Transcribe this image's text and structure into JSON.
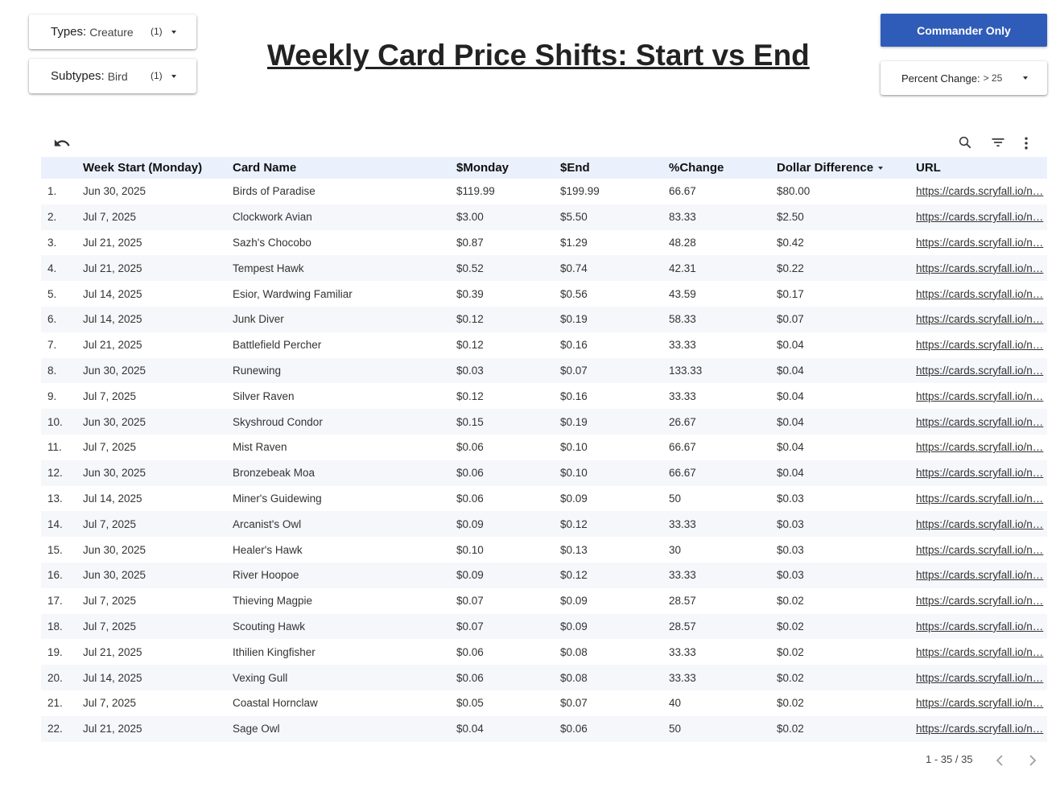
{
  "filters": {
    "types": {
      "label": "Types",
      "value": "Creature",
      "count": "(1)"
    },
    "subtypes": {
      "label": "Subtypes",
      "value": "Bird",
      "count": "(1)"
    },
    "percent": {
      "label": "Percent Change",
      "value": "> 25"
    }
  },
  "title": "Weekly Card Price Shifts: Start vs End",
  "commander_button": "Commander Only",
  "accent_color": "#2f5cb8",
  "table": {
    "columns": [
      "Week Start (Monday)",
      "Card Name",
      "$Monday",
      "$End",
      "%Change",
      "Dollar Difference",
      "URL"
    ],
    "sorted_column": "Dollar Difference",
    "rows": [
      [
        "1.",
        "Jun 30, 2025",
        "Birds of Paradise",
        "$119.99",
        "$199.99",
        "66.67",
        "$80.00",
        "https://cards.scryfall.io/n…"
      ],
      [
        "2.",
        "Jul 7, 2025",
        "Clockwork Avian",
        "$3.00",
        "$5.50",
        "83.33",
        "$2.50",
        "https://cards.scryfall.io/n…"
      ],
      [
        "3.",
        "Jul 21, 2025",
        "Sazh's Chocobo",
        "$0.87",
        "$1.29",
        "48.28",
        "$0.42",
        "https://cards.scryfall.io/n…"
      ],
      [
        "4.",
        "Jul 21, 2025",
        "Tempest Hawk",
        "$0.52",
        "$0.74",
        "42.31",
        "$0.22",
        "https://cards.scryfall.io/n…"
      ],
      [
        "5.",
        "Jul 14, 2025",
        "Esior, Wardwing Familiar",
        "$0.39",
        "$0.56",
        "43.59",
        "$0.17",
        "https://cards.scryfall.io/n…"
      ],
      [
        "6.",
        "Jul 14, 2025",
        "Junk Diver",
        "$0.12",
        "$0.19",
        "58.33",
        "$0.07",
        "https://cards.scryfall.io/n…"
      ],
      [
        "7.",
        "Jul 21, 2025",
        "Battlefield Percher",
        "$0.12",
        "$0.16",
        "33.33",
        "$0.04",
        "https://cards.scryfall.io/n…"
      ],
      [
        "8.",
        "Jun 30, 2025",
        "Runewing",
        "$0.03",
        "$0.07",
        "133.33",
        "$0.04",
        "https://cards.scryfall.io/n…"
      ],
      [
        "9.",
        "Jul 7, 2025",
        "Silver Raven",
        "$0.12",
        "$0.16",
        "33.33",
        "$0.04",
        "https://cards.scryfall.io/n…"
      ],
      [
        "10.",
        "Jun 30, 2025",
        "Skyshroud Condor",
        "$0.15",
        "$0.19",
        "26.67",
        "$0.04",
        "https://cards.scryfall.io/n…"
      ],
      [
        "11.",
        "Jul 7, 2025",
        "Mist Raven",
        "$0.06",
        "$0.10",
        "66.67",
        "$0.04",
        "https://cards.scryfall.io/n…"
      ],
      [
        "12.",
        "Jun 30, 2025",
        "Bronzebeak Moa",
        "$0.06",
        "$0.10",
        "66.67",
        "$0.04",
        "https://cards.scryfall.io/n…"
      ],
      [
        "13.",
        "Jul 14, 2025",
        "Miner's Guidewing",
        "$0.06",
        "$0.09",
        "50",
        "$0.03",
        "https://cards.scryfall.io/n…"
      ],
      [
        "14.",
        "Jul 7, 2025",
        "Arcanist's Owl",
        "$0.09",
        "$0.12",
        "33.33",
        "$0.03",
        "https://cards.scryfall.io/n…"
      ],
      [
        "15.",
        "Jun 30, 2025",
        "Healer's Hawk",
        "$0.10",
        "$0.13",
        "30",
        "$0.03",
        "https://cards.scryfall.io/n…"
      ],
      [
        "16.",
        "Jun 30, 2025",
        "River Hoopoe",
        "$0.09",
        "$0.12",
        "33.33",
        "$0.03",
        "https://cards.scryfall.io/n…"
      ],
      [
        "17.",
        "Jul 7, 2025",
        "Thieving Magpie",
        "$0.07",
        "$0.09",
        "28.57",
        "$0.02",
        "https://cards.scryfall.io/n…"
      ],
      [
        "18.",
        "Jul 7, 2025",
        "Scouting Hawk",
        "$0.07",
        "$0.09",
        "28.57",
        "$0.02",
        "https://cards.scryfall.io/n…"
      ],
      [
        "19.",
        "Jul 21, 2025",
        "Ithilien Kingfisher",
        "$0.06",
        "$0.08",
        "33.33",
        "$0.02",
        "https://cards.scryfall.io/n…"
      ],
      [
        "20.",
        "Jul 14, 2025",
        "Vexing Gull",
        "$0.06",
        "$0.08",
        "33.33",
        "$0.02",
        "https://cards.scryfall.io/n…"
      ],
      [
        "21.",
        "Jul 7, 2025",
        "Coastal Hornclaw",
        "$0.05",
        "$0.07",
        "40",
        "$0.02",
        "https://cards.scryfall.io/n…"
      ],
      [
        "22.",
        "Jul 21, 2025",
        "Sage Owl",
        "$0.04",
        "$0.06",
        "50",
        "$0.02",
        "https://cards.scryfall.io/n…"
      ]
    ]
  },
  "pagination": {
    "range": "1 - 35 / 35"
  },
  "icons": {
    "undo": "undo-icon",
    "search": "search-icon",
    "filter": "filter-icon",
    "more": "more-vert-icon",
    "prev": "chevron-left-icon",
    "next": "chevron-right-icon"
  }
}
